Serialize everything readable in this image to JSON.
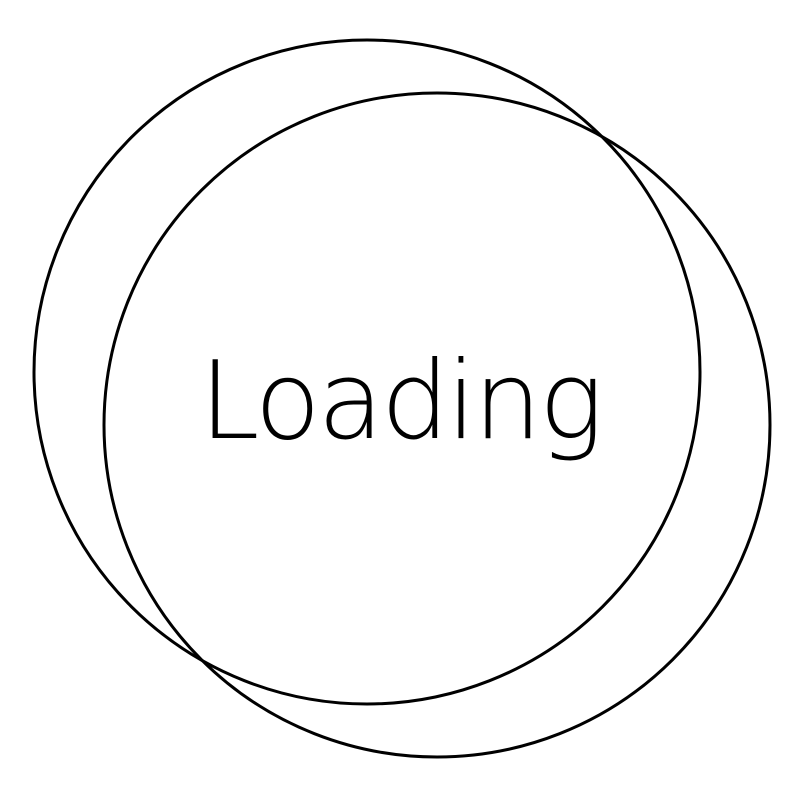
{
  "loading": {
    "label": "Loading"
  },
  "icons": {
    "outer_ring": "ring-icon",
    "inner_ring": "ring-icon"
  },
  "colors": {
    "background": "#ffffff",
    "stroke": "#000000",
    "text": "#000000"
  }
}
